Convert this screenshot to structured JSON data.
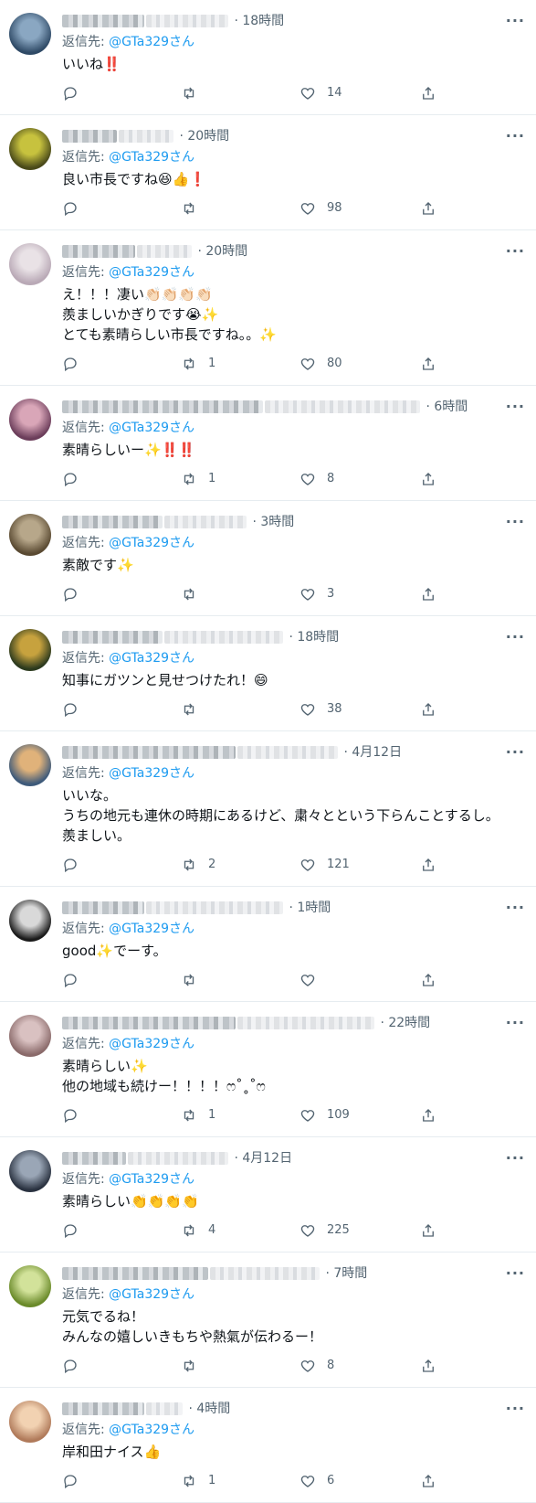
{
  "reply_prefix": "返信先: ",
  "more_label": "···",
  "tweets": [
    {
      "time": "18時間",
      "handle": "@GTa329さん",
      "text": "いいね‼️",
      "replies": "",
      "retweets": "",
      "likes": "14",
      "avatar": [
        "#2f4a66",
        "#8aa7c2"
      ]
    },
    {
      "time": "20時間",
      "handle": "@GTa329さん",
      "text": "良い市長ですね😆👍❗",
      "replies": "",
      "retweets": "",
      "likes": "98",
      "avatar": [
        "#4a4a1a",
        "#c7c23e"
      ]
    },
    {
      "time": "20時間",
      "handle": "@GTa329さん",
      "text": "え！！！凄い👏🏻👏🏻👏🏻👏🏻\n羨ましいかぎりです😭✨\nとても素晴らしい市長ですね。。✨",
      "replies": "",
      "retweets": "1",
      "likes": "80",
      "avatar": [
        "#b9a9b6",
        "#e9e2e6"
      ]
    },
    {
      "time": "6時間",
      "handle": "@GTa329さん",
      "text": "素晴らしいー✨‼️‼️",
      "replies": "",
      "retweets": "1",
      "likes": "8",
      "avatar": [
        "#6b3d5a",
        "#d9a6b8"
      ]
    },
    {
      "time": "3時間",
      "handle": "@GTa329さん",
      "text": "素敵です✨",
      "replies": "",
      "retweets": "",
      "likes": "3",
      "avatar": [
        "#5a4a32",
        "#b7a78a"
      ]
    },
    {
      "time": "18時間",
      "handle": "@GTa329さん",
      "text": "知事にガツンと見せつけたれ！😄",
      "replies": "",
      "retweets": "",
      "likes": "38",
      "avatar": [
        "#2c3a1e",
        "#c7a23e"
      ]
    },
    {
      "time": "4月12日",
      "handle": "@GTa329さん",
      "text": "いいな。\nうちの地元も連休の時期にあるけど、粛々とという下らんことするし。\n羨ましい。",
      "replies": "",
      "retweets": "2",
      "likes": "121",
      "avatar": [
        "#3e5a7a",
        "#e0b27a"
      ]
    },
    {
      "time": "1時間",
      "handle": "@GTa329さん",
      "text": "good✨でーす。",
      "replies": "",
      "retweets": "",
      "likes": "",
      "avatar": [
        "#1a1a1a",
        "#d9d9d9"
      ]
    },
    {
      "time": "22時間",
      "handle": "@GTa329さん",
      "text": "素晴らしい✨\n他の地域も続けー！！！！ෆ˚˳˚ෆ",
      "replies": "",
      "retweets": "1",
      "likes": "109",
      "avatar": [
        "#8a6a6a",
        "#d9c1c1"
      ]
    },
    {
      "time": "4月12日",
      "handle": "@GTa329さん",
      "text": "素晴らしい👏👏👏👏",
      "replies": "",
      "retweets": "4",
      "likes": "225",
      "avatar": [
        "#2a3240",
        "#9aa6b6"
      ]
    },
    {
      "time": "7時間",
      "handle": "@GTa329さん",
      "text": "元気でるね！\nみんなの嬉しいきもちや熱氣が伝わるー！",
      "replies": "",
      "retweets": "",
      "likes": "8",
      "avatar": [
        "#6a8a2a",
        "#d2e29a"
      ]
    },
    {
      "time": "4時間",
      "handle": "@GTa329さん",
      "text": "岸和田ナイス👍",
      "replies": "",
      "retweets": "1",
      "likes": "6",
      "avatar": [
        "#b07a5a",
        "#f2d2b2"
      ]
    }
  ]
}
